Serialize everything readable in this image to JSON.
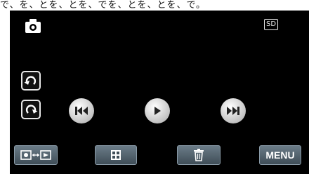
{
  "caption_text": "で、を、とを、とを、でを、とを、とを、で。",
  "status": {
    "storage": "SD"
  },
  "icons": {
    "mode": "still-camera-icon",
    "rotate_left": "rotate-left-icon",
    "rotate_right": "rotate-right-icon",
    "previous": "skip-previous-icon",
    "play": "play-icon",
    "next": "skip-next-icon",
    "playback_switch": "playback-switch-icon",
    "index": "index-view-icon",
    "delete": "trash-icon"
  },
  "bottom_bar": {
    "menu_label": "MENU"
  },
  "colors": {
    "screen_bg": "#000000",
    "button_gradient_top": "#6b7c88",
    "button_gradient_bottom": "#3f4d57",
    "icon_white": "#ffffff"
  }
}
